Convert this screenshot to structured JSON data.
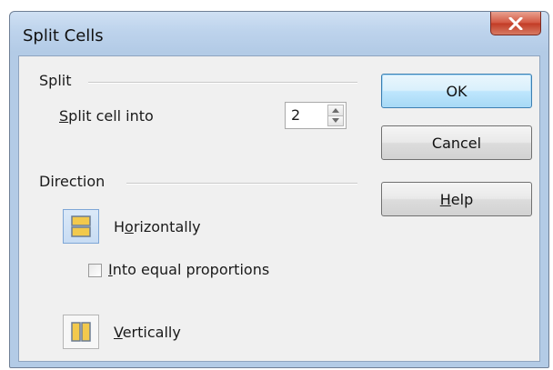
{
  "window": {
    "title": "Split Cells",
    "close_label": "X"
  },
  "split": {
    "section_label": "Split",
    "field_label_prefix": "",
    "field_label_mnemonic": "S",
    "field_label_rest": "plit cell into",
    "value": "2"
  },
  "direction": {
    "section_label": "Direction",
    "horizontal": {
      "mnemonic_prefix": "H",
      "mnemonic": "o",
      "rest": "rizontally",
      "selected": true
    },
    "equal_proportions": {
      "mnemonic": "I",
      "rest": "nto equal proportions",
      "checked": false
    },
    "vertical": {
      "mnemonic": "V",
      "rest": "ertically",
      "selected": false
    }
  },
  "buttons": {
    "ok": "OK",
    "cancel": "Cancel",
    "help_mnemonic": "H",
    "help_rest": "elp"
  },
  "colors": {
    "icon_fill": "#f2c94c",
    "icon_stroke": "#6b7c93",
    "close_red": "#c23b25"
  },
  "icons": {
    "horizontal": "split-horizontal-icon",
    "vertical": "split-vertical-icon",
    "close": "close-icon",
    "spin_up": "chevron-up-icon",
    "spin_down": "chevron-down-icon"
  }
}
